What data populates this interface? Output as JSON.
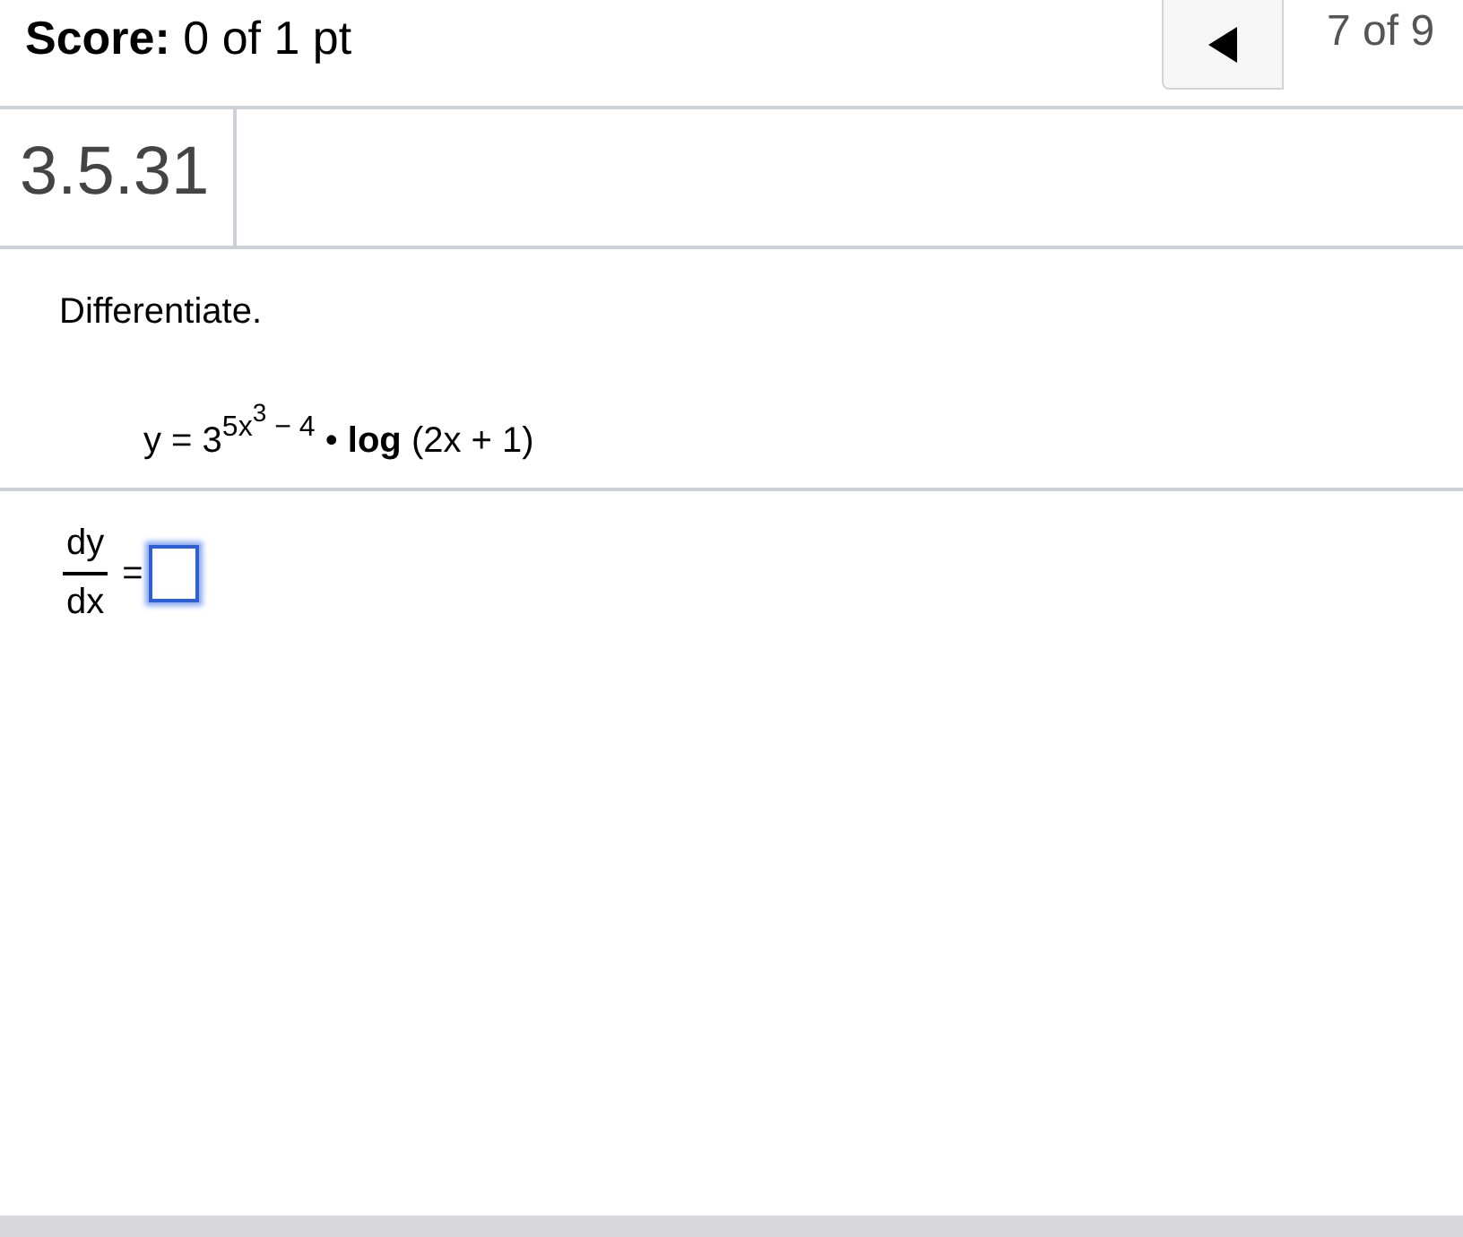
{
  "header": {
    "score_label": "Score:",
    "score_value": "0 of 1 pt",
    "position": "7 of 9"
  },
  "problem": {
    "number": "3.5.31",
    "instruction": "Differentiate.",
    "equation": [
      {
        "kind": "text",
        "text": "y = 3"
      },
      {
        "kind": "sup",
        "text": "5x"
      },
      {
        "kind": "supsup",
        "text": "3"
      },
      {
        "kind": "sup",
        "text": " − 4"
      },
      {
        "kind": "text",
        "text": " • "
      },
      {
        "kind": "bold",
        "text": "log"
      },
      {
        "kind": "text",
        "text": " (2x + 1)"
      }
    ]
  },
  "answer": {
    "numerator": "dy",
    "denominator": "dx",
    "equals": "=",
    "focused": true
  }
}
